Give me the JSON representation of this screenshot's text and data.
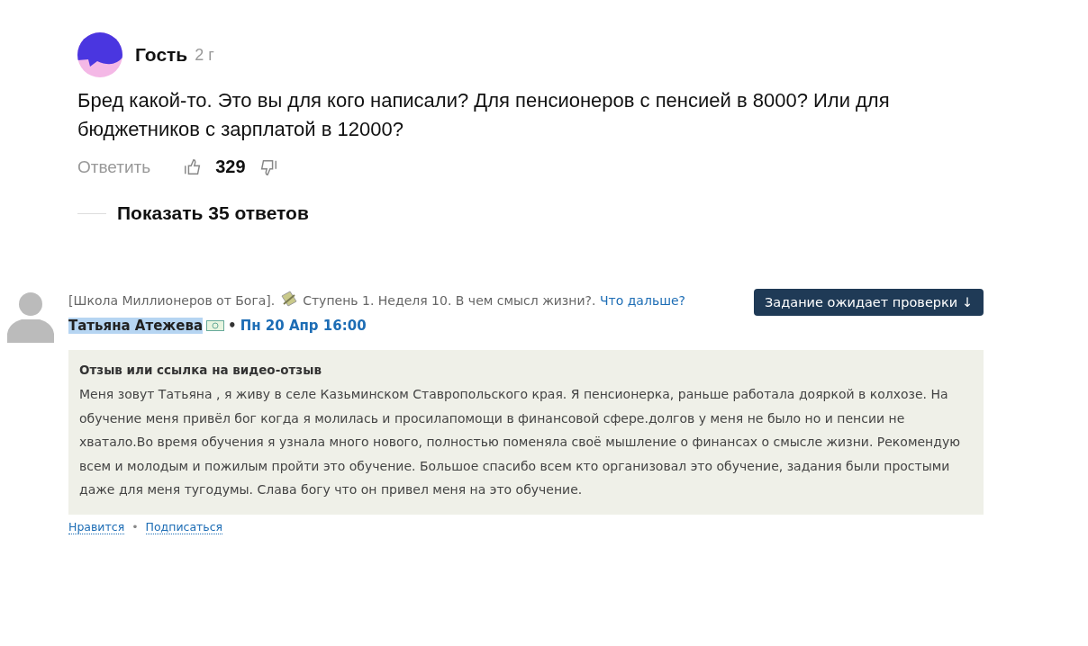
{
  "comment": {
    "author": "Гость",
    "age": "2 г",
    "text": "Бред какой-то. Это вы для кого написали? Для пенсионеров с пенсией в 8000? Или для бюджетников с зарплатой в 12000?",
    "reply": "Ответить",
    "likes": "329",
    "show_replies": "Показать 35 ответов"
  },
  "screenshot": {
    "course": "[Школа Миллионеров от Бога].",
    "step": "Ступень 1. Неделя 10. В чем смысл жизни?.",
    "next_link": "Что дальше?",
    "status_button": "Задание ожидает проверки ↓",
    "author": "Татьяна Атежева",
    "author_selected": true,
    "separator": "•",
    "date": "Пн 20 Апр 16:00",
    "field_label": "Отзыв или ссылка на видео-отзыв",
    "body": "Меня зовут Татьяна , я живу в селе Казьминском Ставропольского края. Я пенсионерка, раньше работала дояркой в колхозе. На обучение меня привёл бог когда я молилась и просилапомощи в финансовой сфере.долгов у меня не было но и пенсии не хватало.Во время обучения я узнала много нового, полностью поменяла своё мышление о финансах о смысле жизни. Рекомендую всем и молодым и пожилым пройти это обучение. Большое спасибо всем кто организовал это обучение, задания были простыми даже для меня тугодумы. Слава богу что он привел меня на это обучение.",
    "links": [
      "Нравится",
      "Подписаться"
    ],
    "links_separator": "•"
  }
}
